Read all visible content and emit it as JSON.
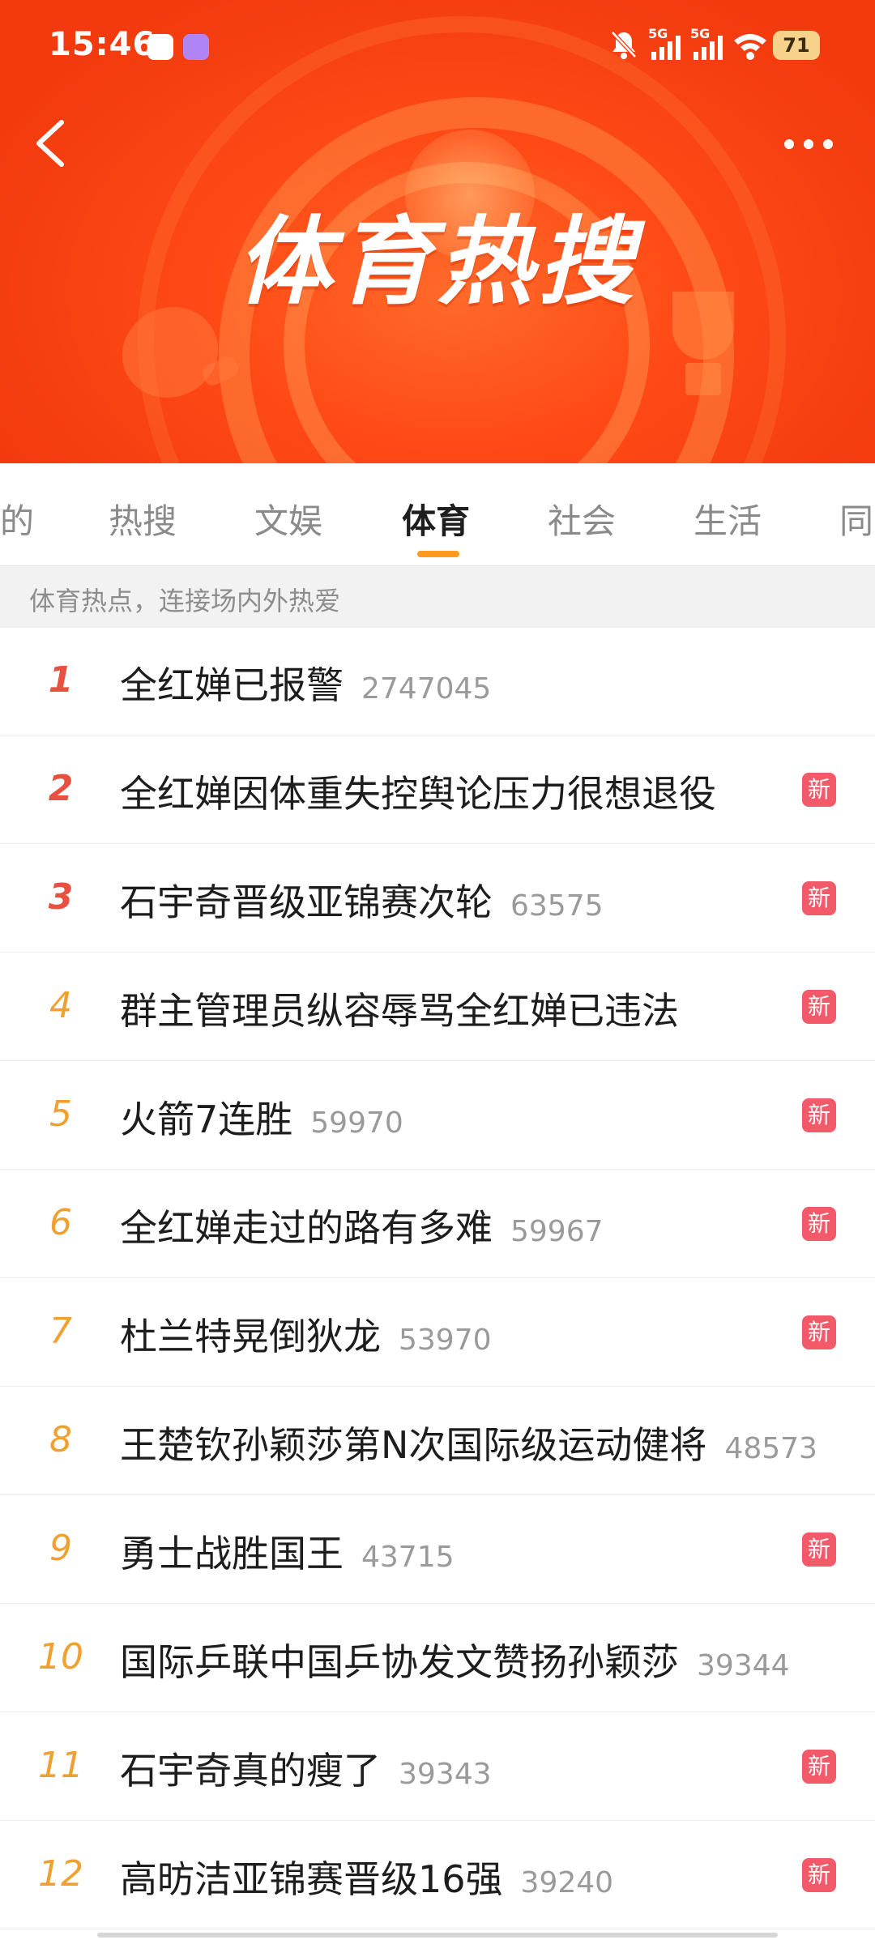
{
  "status_bar": {
    "time": "15:46",
    "network_1": "5G",
    "network_2": "5G",
    "battery": "71",
    "icons": [
      "mute-bell-icon",
      "signal-icon",
      "signal-icon",
      "wifi-icon"
    ]
  },
  "header": {
    "banner_title": "体育热搜",
    "back_icon": "chevron-left-icon",
    "more_icon": "ellipsis-icon"
  },
  "tabs": [
    {
      "label": "的"
    },
    {
      "label": "热搜"
    },
    {
      "label": "文娱"
    },
    {
      "label": "体育"
    },
    {
      "label": "社会"
    },
    {
      "label": "生活"
    },
    {
      "label": "同"
    }
  ],
  "active_tab": "体育",
  "subtitle": "体育热点，连接场内外热爱",
  "new_badge_label": "新",
  "colors": {
    "banner": "#f23a0e",
    "rank_top": "#e8513f",
    "rank_other": "#f0a030",
    "new_badge": "#f25a6a",
    "tab_underline": "#ff9a1e"
  },
  "list": [
    {
      "rank": "1",
      "title": "全红婵已报警",
      "count": "2747045",
      "is_new": false
    },
    {
      "rank": "2",
      "title": "全红婵因体重失控舆论压力很想退役",
      "count": "",
      "is_new": true
    },
    {
      "rank": "3",
      "title": "石宇奇晋级亚锦赛次轮",
      "count": "63575",
      "is_new": true
    },
    {
      "rank": "4",
      "title": "群主管理员纵容辱骂全红婵已违法",
      "count": "",
      "is_new": true
    },
    {
      "rank": "5",
      "title": "火箭7连胜",
      "count": "59970",
      "is_new": true
    },
    {
      "rank": "6",
      "title": "全红婵走过的路有多难",
      "count": "59967",
      "is_new": true
    },
    {
      "rank": "7",
      "title": "杜兰特晃倒狄龙",
      "count": "53970",
      "is_new": true
    },
    {
      "rank": "8",
      "title": "王楚钦孙颖莎第N次国际级运动健将",
      "count": "48573",
      "is_new": false
    },
    {
      "rank": "9",
      "title": "勇士战胜国王",
      "count": "43715",
      "is_new": true
    },
    {
      "rank": "10",
      "title": "国际乒联中国乒协发文赞扬孙颖莎",
      "count": "39344",
      "is_new": false
    },
    {
      "rank": "11",
      "title": "石宇奇真的瘦了",
      "count": "39343",
      "is_new": true
    },
    {
      "rank": "12",
      "title": "高昉洁亚锦赛晋级16强",
      "count": "39240",
      "is_new": true
    }
  ]
}
